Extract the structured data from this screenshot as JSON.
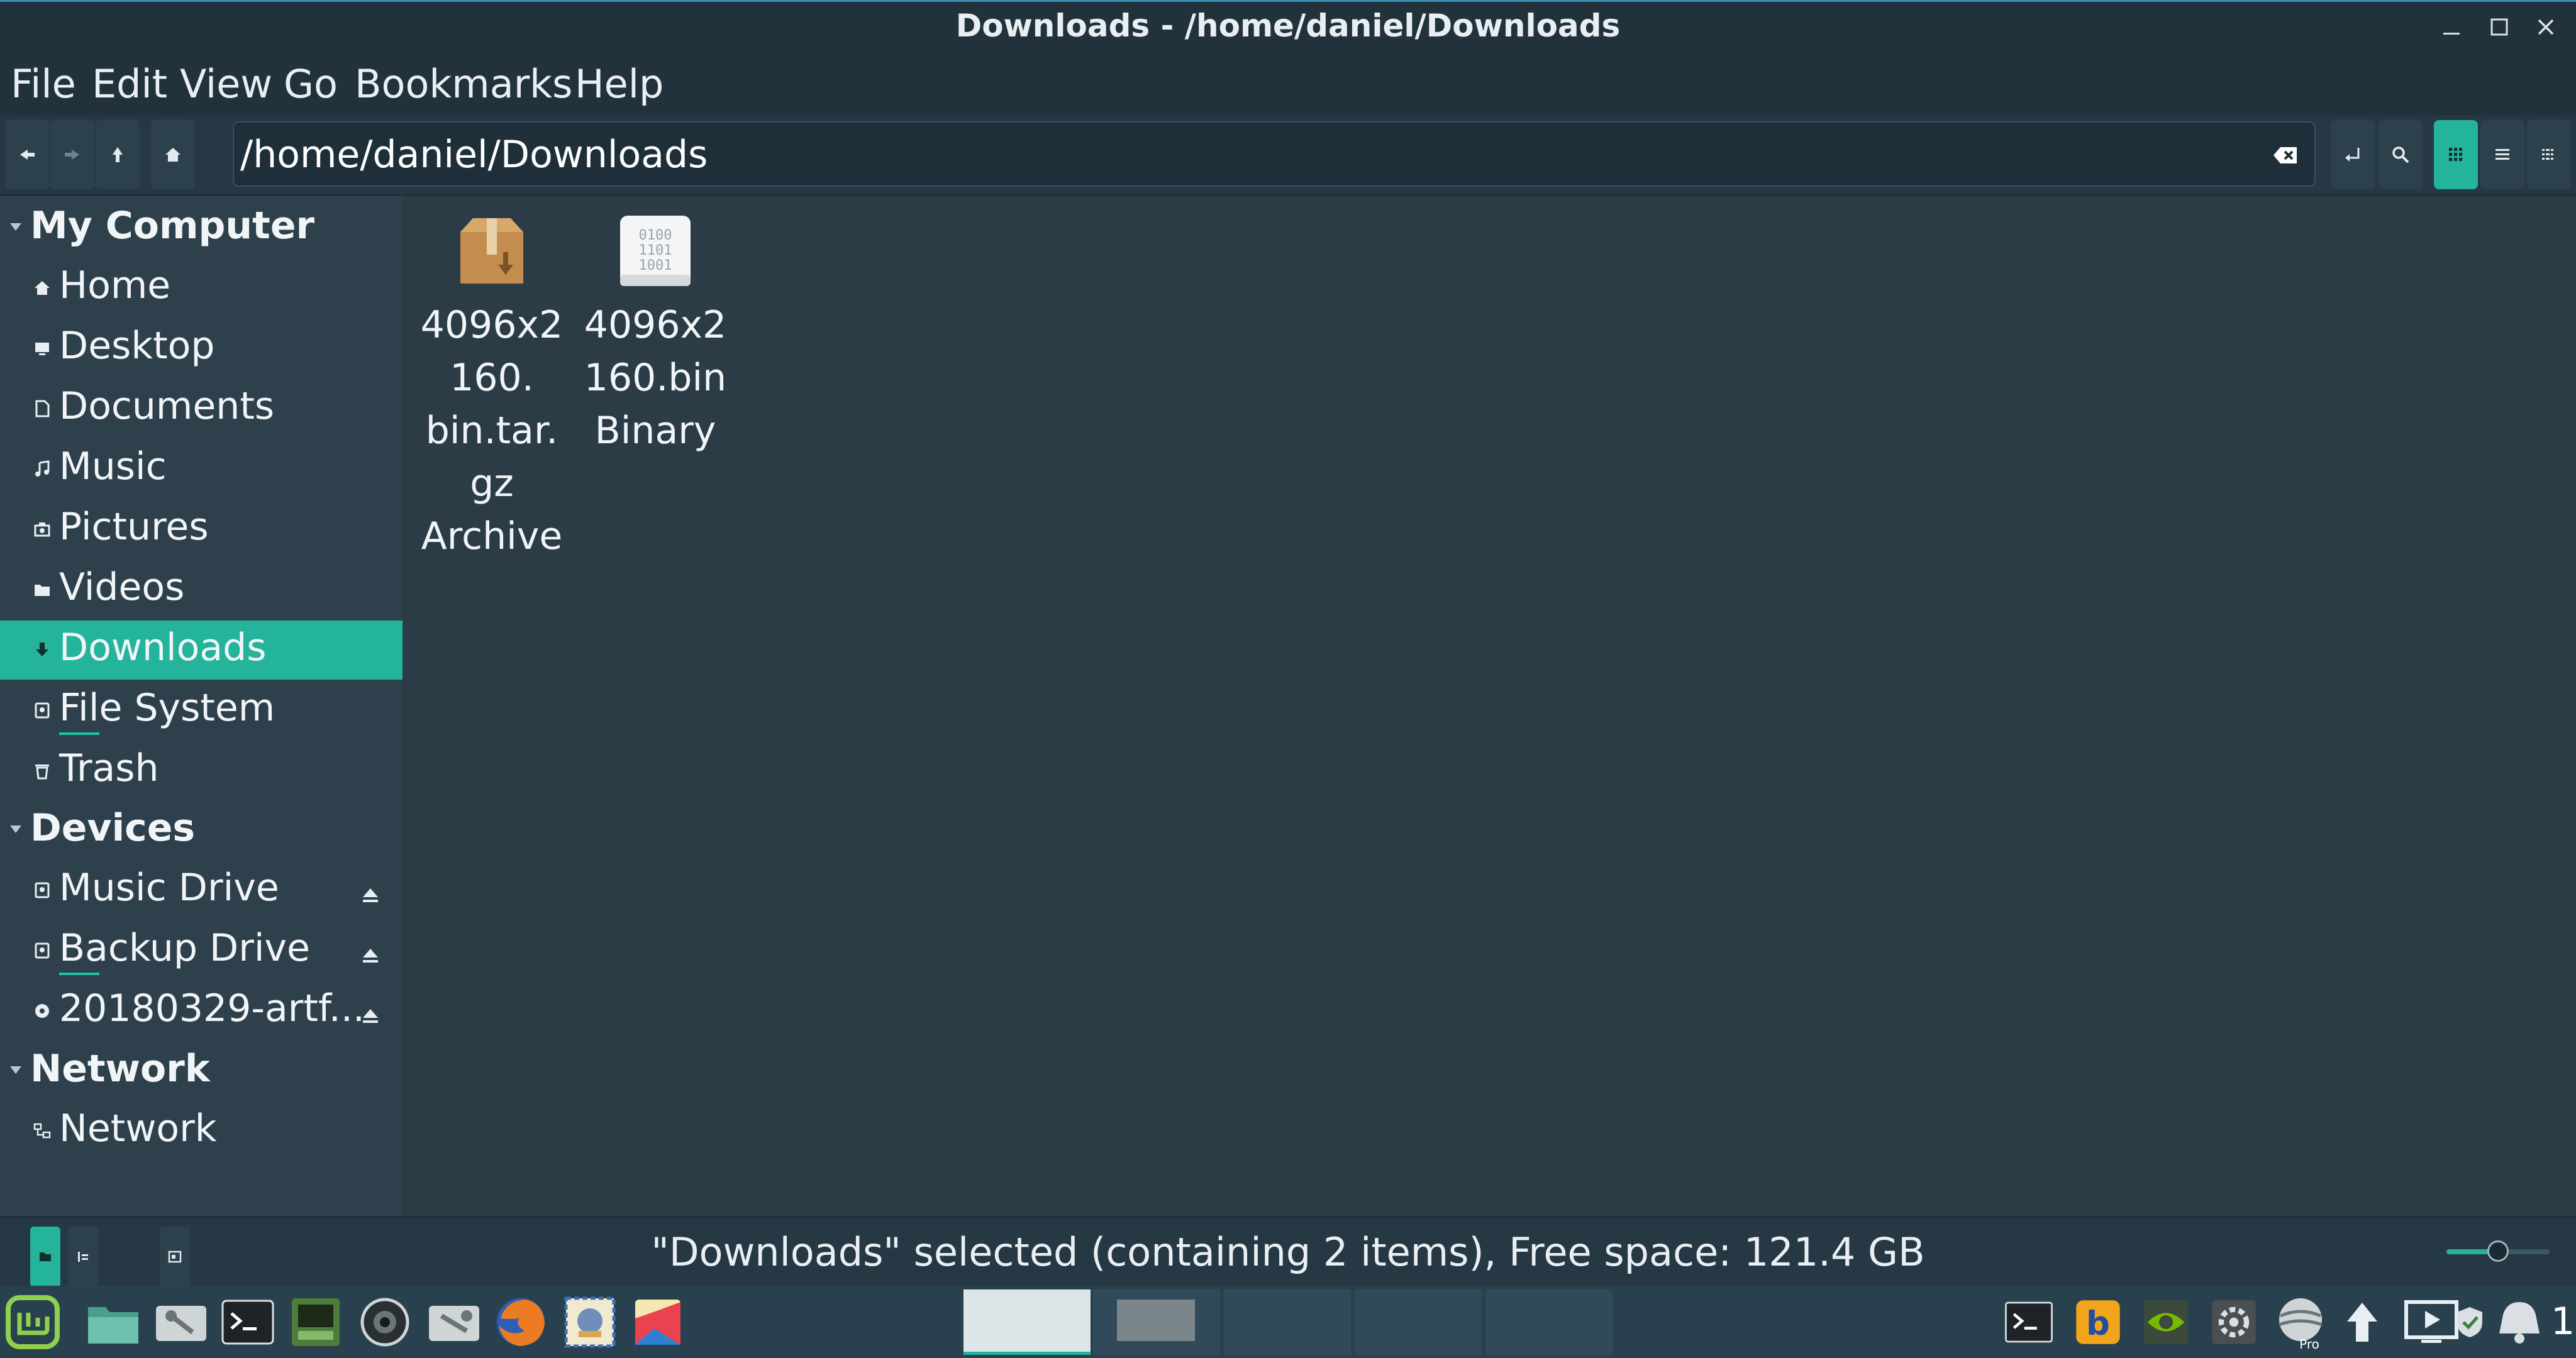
{
  "window": {
    "title": "Downloads - /home/daniel/Downloads",
    "controls": [
      "minimize-icon",
      "maximize-icon",
      "close-icon"
    ]
  },
  "menu": {
    "items": [
      "File",
      "Edit",
      "View",
      "Go",
      "Bookmarks",
      "Help"
    ]
  },
  "toolbar": {
    "nav_buttons": [
      "back-icon",
      "forward-icon",
      "up-icon",
      "home-icon"
    ],
    "location_value": "/home/daniel/Downloads",
    "right_buttons": [
      "toggle-location-icon",
      "search-icon"
    ],
    "view_buttons": [
      "icon-view-icon",
      "list-view-icon",
      "compact-view-icon"
    ],
    "active_view": "icon"
  },
  "sidebar": {
    "sections": [
      {
        "title": "My Computer",
        "items": [
          {
            "label": "Home",
            "icon": "home-icon"
          },
          {
            "label": "Desktop",
            "icon": "desktop-icon"
          },
          {
            "label": "Documents",
            "icon": "documents-icon"
          },
          {
            "label": "Music",
            "icon": "music-icon"
          },
          {
            "label": "Pictures",
            "icon": "pictures-icon"
          },
          {
            "label": "Videos",
            "icon": "videos-icon"
          },
          {
            "label": "Downloads",
            "icon": "download-icon",
            "selected": true
          },
          {
            "label": "File System",
            "icon": "drive-icon"
          },
          {
            "label": "Trash",
            "icon": "trash-icon"
          }
        ]
      },
      {
        "title": "Devices",
        "items": [
          {
            "label": "Music Drive",
            "icon": "drive-icon",
            "eject": true
          },
          {
            "label": "Backup Drive",
            "icon": "drive-icon",
            "eject": true
          },
          {
            "label": "20180329-artf...",
            "icon": "disc-icon",
            "eject": true
          }
        ]
      },
      {
        "title": "Network",
        "items": [
          {
            "label": "Network",
            "icon": "network-icon"
          }
        ]
      }
    ]
  },
  "files": [
    {
      "name": "4096x2160.bin.tar.gz",
      "name_display": [
        "4096x2",
        "160.",
        "bin.tar.",
        "gz"
      ],
      "type": "Archive",
      "icon": "archive-icon"
    },
    {
      "name": "4096x2160.bin",
      "name_display": [
        "4096x2",
        "160.bin"
      ],
      "type": "Binary",
      "icon": "binary-file-icon",
      "icon_text": [
        "0100",
        "1101",
        "1001"
      ]
    }
  ],
  "statusbar": {
    "text": "\"Downloads\" selected (containing 2 items), Free space: 121.4 GB",
    "sidebar_toggles": [
      "places-toggle-icon",
      "tree-toggle-icon"
    ],
    "zoom_fraction": 0.5
  },
  "taskbar": {
    "launchers": [
      "mint-menu-icon",
      "files-icon",
      "settings-icon",
      "terminal-icon",
      "system-monitor-icon",
      "camera-icon",
      "tools-icon",
      "firefox-icon",
      "mail-icon",
      "image-viewer-icon"
    ],
    "tray": [
      "terminal-tray-icon",
      "bluetooth-icon",
      "nvidia-icon",
      "settings-tray-icon",
      "vpn-icon",
      "update-icon",
      "media-icon",
      "shield-icon",
      "notifications-icon"
    ],
    "tray_labels": {
      "vpn-badge": "Pro",
      "notification_count": "1"
    }
  },
  "colors": {
    "accent": "#24b39b",
    "background": "#2b3c47",
    "sidebar": "#2e404b",
    "titlebar": "#22323c"
  }
}
